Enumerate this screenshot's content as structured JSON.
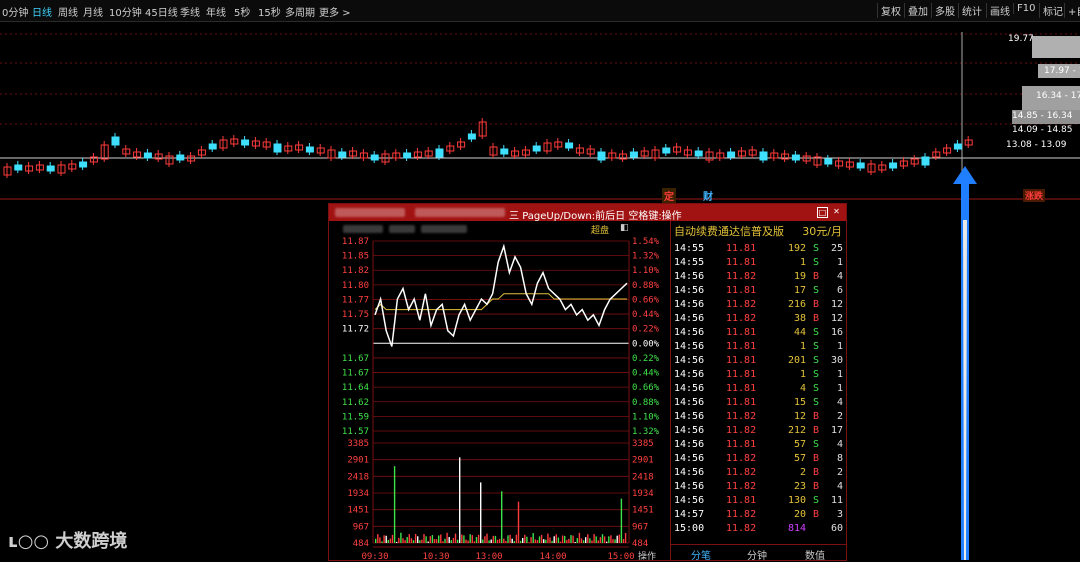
{
  "toolbar": {
    "periods": [
      "0分钟",
      "日线",
      "周线",
      "月线",
      "10分钟",
      "45日线",
      "季线",
      "年线",
      "5秒",
      "15秒",
      "多周期",
      "更多 >"
    ],
    "active_period": "日线",
    "right_buttons": [
      "复权",
      "叠加",
      "多股",
      "统计",
      "画线",
      "F10",
      "标记",
      "+自"
    ]
  },
  "kline": {
    "price_labels": [
      "19.77",
      "17.97 - 1",
      "16.34 - 17",
      "14.85 - 16.34",
      "14.09 - 14.85",
      "13.08 - 13.09"
    ],
    "markers": {
      "ding": "定",
      "cai": "财",
      "limit_up": "涨跌"
    },
    "colors": {
      "up": "#ff3b3b",
      "down": "#3fe0ff",
      "arrow": "#2b8cff"
    }
  },
  "popup": {
    "title": "PageUp/Down:前后日 空格键:操作",
    "prefix": "三",
    "mode_label": "超盘",
    "left_price_labels": [
      "11.87",
      "11.85",
      "11.82",
      "11.80",
      "11.77",
      "11.75",
      "11.72",
      "11.67",
      "11.67",
      "11.64",
      "11.62",
      "11.59",
      "11.57"
    ],
    "right_pct_labels": [
      "1.54%",
      "1.32%",
      "1.10%",
      "0.88%",
      "0.66%",
      "0.44%",
      "0.22%",
      "0.00%",
      "0.22%",
      "0.44%",
      "0.66%",
      "0.88%",
      "1.10%",
      "1.32%"
    ],
    "volume_labels": [
      "3385",
      "2901",
      "2418",
      "1934",
      "1451",
      "967",
      "484"
    ],
    "time_labels": [
      "09:30",
      "10:30",
      "13:00",
      "14:00",
      "15:00"
    ],
    "operate_label": "操作",
    "chart_data": {
      "type": "line",
      "title": "",
      "prev_close": 11.72,
      "ylim": [
        11.54,
        11.9
      ],
      "price_series": [
        11.76,
        11.79,
        11.73,
        11.7,
        11.79,
        11.81,
        11.77,
        11.79,
        11.75,
        11.8,
        11.74,
        11.77,
        11.78,
        11.73,
        11.72,
        11.76,
        11.78,
        11.75,
        11.77,
        11.79,
        11.78,
        11.8,
        11.86,
        11.89,
        11.84,
        11.87,
        11.85,
        11.8,
        11.78,
        11.82,
        11.84,
        11.81,
        11.8,
        11.79,
        11.77,
        11.78,
        11.76,
        11.77,
        11.75,
        11.76,
        11.74,
        11.77,
        11.79,
        11.8,
        11.81,
        11.82
      ],
      "avg_series": [
        11.77,
        11.78,
        11.77,
        11.77,
        11.77,
        11.77,
        11.77,
        11.77,
        11.77,
        11.77,
        11.77,
        11.77,
        11.77,
        11.77,
        11.77,
        11.77,
        11.77,
        11.77,
        11.77,
        11.77,
        11.78,
        11.79,
        11.79,
        11.8,
        11.8,
        11.8,
        11.8,
        11.8,
        11.8,
        11.8,
        11.8,
        11.8,
        11.79,
        11.79,
        11.79,
        11.79,
        11.79,
        11.79,
        11.79,
        11.79,
        11.79,
        11.79,
        11.79,
        11.79,
        11.79,
        11.79
      ],
      "volume_ylim": [
        0,
        3385
      ]
    }
  },
  "ticks": {
    "header": "自动续费通达信普及版",
    "price_tag": "30元/月",
    "rows": [
      {
        "time": "14:55",
        "price": "11.81",
        "vol": "192",
        "bs": "S",
        "n": "25"
      },
      {
        "time": "14:55",
        "price": "11.81",
        "vol": "1",
        "bs": "S",
        "n": "1"
      },
      {
        "time": "14:56",
        "price": "11.82",
        "vol": "19",
        "bs": "B",
        "n": "4"
      },
      {
        "time": "14:56",
        "price": "11.81",
        "vol": "17",
        "bs": "S",
        "n": "6"
      },
      {
        "time": "14:56",
        "price": "11.82",
        "vol": "216",
        "bs": "B",
        "n": "12"
      },
      {
        "time": "14:56",
        "price": "11.82",
        "vol": "38",
        "bs": "B",
        "n": "12"
      },
      {
        "time": "14:56",
        "price": "11.81",
        "vol": "44",
        "bs": "S",
        "n": "16"
      },
      {
        "time": "14:56",
        "price": "11.81",
        "vol": "1",
        "bs": "S",
        "n": "1"
      },
      {
        "time": "14:56",
        "price": "11.81",
        "vol": "201",
        "bs": "S",
        "n": "30"
      },
      {
        "time": "14:56",
        "price": "11.81",
        "vol": "1",
        "bs": "S",
        "n": "1"
      },
      {
        "time": "14:56",
        "price": "11.81",
        "vol": "4",
        "bs": "S",
        "n": "1"
      },
      {
        "time": "14:56",
        "price": "11.81",
        "vol": "15",
        "bs": "S",
        "n": "4"
      },
      {
        "time": "14:56",
        "price": "11.82",
        "vol": "12",
        "bs": "B",
        "n": "2"
      },
      {
        "time": "14:56",
        "price": "11.82",
        "vol": "212",
        "bs": "B",
        "n": "17"
      },
      {
        "time": "14:56",
        "price": "11.81",
        "vol": "57",
        "bs": "S",
        "n": "4"
      },
      {
        "time": "14:56",
        "price": "11.82",
        "vol": "57",
        "bs": "B",
        "n": "8"
      },
      {
        "time": "14:56",
        "price": "11.82",
        "vol": "2",
        "bs": "B",
        "n": "2"
      },
      {
        "time": "14:56",
        "price": "11.82",
        "vol": "23",
        "bs": "B",
        "n": "4"
      },
      {
        "time": "14:56",
        "price": "11.81",
        "vol": "130",
        "bs": "S",
        "n": "11"
      },
      {
        "time": "14:57",
        "price": "11.82",
        "vol": "20",
        "bs": "B",
        "n": "3"
      },
      {
        "time": "15:00",
        "price": "11.82",
        "vol": "814",
        "bs": "",
        "n": "60"
      }
    ],
    "footer": [
      "分笔",
      "分钟",
      "数值"
    ]
  },
  "watermark": "大数跨境"
}
